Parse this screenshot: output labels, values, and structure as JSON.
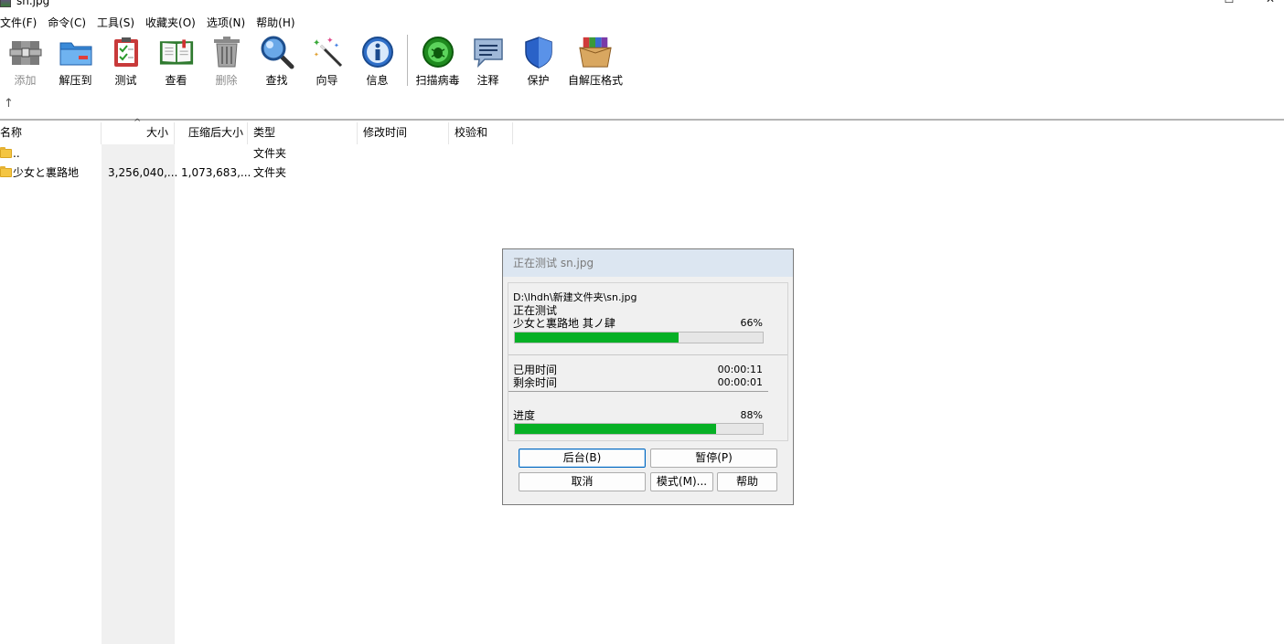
{
  "window": {
    "title": "sn.jpg",
    "minimize_glyph": "—",
    "maximize_glyph": "☐",
    "close_glyph": "✕"
  },
  "menu": [
    "文件(F)",
    "命令(C)",
    "工具(S)",
    "收藏夹(O)",
    "选项(N)",
    "帮助(H)"
  ],
  "toolbar": [
    {
      "label": "添加",
      "icon": "add-archive-icon",
      "enabled": false
    },
    {
      "label": "解压到",
      "icon": "extract-folder-icon",
      "enabled": true
    },
    {
      "label": "测试",
      "icon": "test-clipboard-icon",
      "enabled": true
    },
    {
      "label": "查看",
      "icon": "view-book-icon",
      "enabled": true
    },
    {
      "label": "删除",
      "icon": "trash-icon",
      "enabled": false
    },
    {
      "label": "查找",
      "icon": "magnifier-icon",
      "enabled": true
    },
    {
      "label": "向导",
      "icon": "wizard-wand-icon",
      "enabled": true
    },
    {
      "label": "信息",
      "icon": "info-icon",
      "enabled": true
    },
    {
      "label": "扫描病毒",
      "icon": "virus-scan-icon",
      "enabled": true
    },
    {
      "label": "注释",
      "icon": "comment-icon",
      "enabled": true
    },
    {
      "label": "保护",
      "icon": "shield-icon",
      "enabled": true
    },
    {
      "label": "自解压格式",
      "icon": "sfx-box-icon",
      "enabled": true
    }
  ],
  "nav": {
    "up_glyph": "↑",
    "sort_glyph": "^"
  },
  "columns": {
    "name": "名称",
    "size": "大小",
    "packed": "压缩后大小",
    "type": "类型",
    "modified": "修改时间",
    "crc": "校验和"
  },
  "rows": [
    {
      "name": "..",
      "size": "",
      "packed": "",
      "type": "文件夹"
    },
    {
      "name": "少女と裏路地",
      "size": "3,256,040,...",
      "packed": "1,073,683,...",
      "type": "文件夹"
    }
  ],
  "dialog": {
    "title": "正在测试 sn.jpg",
    "archive_path": "D:\\lhdh\\新建文件夹\\sn.jpg",
    "operation": "正在测试",
    "current_file": "少女と裏路地  其ノ肆",
    "file_percent_text": "66%",
    "file_progress": 66,
    "elapsed_label": "已用时间",
    "elapsed_value": "00:00:11",
    "remaining_label": "剩余时间",
    "remaining_value": "00:00:01",
    "progress_label": "进度",
    "total_percent_text": "88%",
    "total_progress": 81,
    "buttons": {
      "background": "后台(B)",
      "pause": "暂停(P)",
      "cancel": "取消",
      "mode": "模式(M)...",
      "help": "帮助"
    }
  },
  "colors": {
    "progress_fill": "#06b025",
    "dialog_title_bg": "#dce6f1",
    "focus_border": "#0067c0"
  }
}
